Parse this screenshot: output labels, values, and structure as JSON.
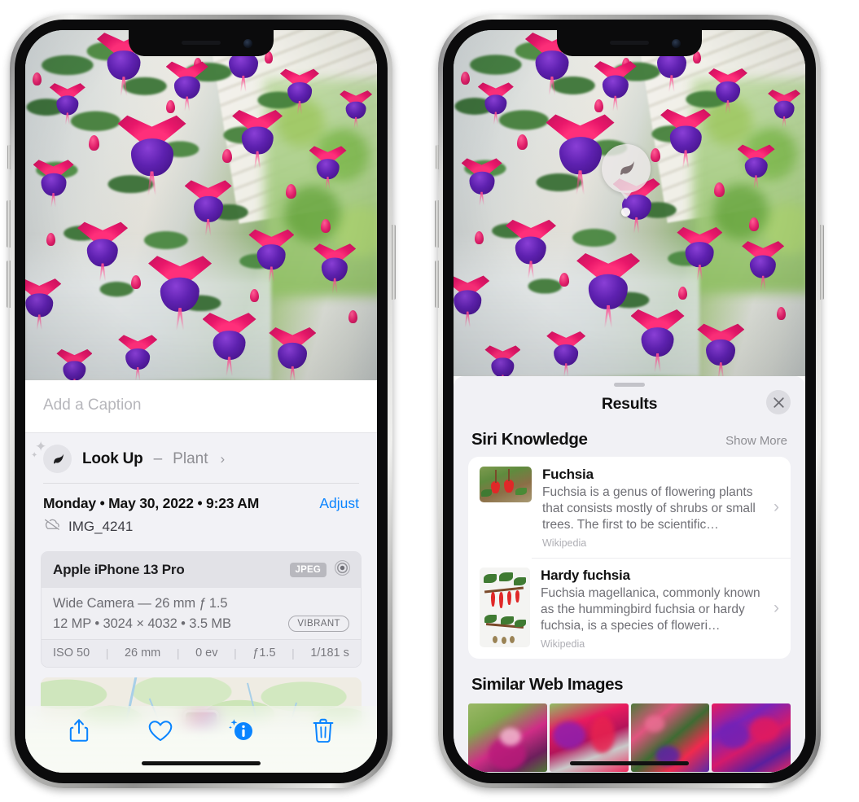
{
  "left_phone": {
    "caption_field": {
      "placeholder": "Add a Caption",
      "value": ""
    },
    "lookup": {
      "icon": "leaf-icon",
      "sparkle_icon": "sparkles-icon",
      "title": "Look Up",
      "dash": "–",
      "kind": "Plant",
      "chevron": "›"
    },
    "meta": {
      "date": "Monday • May 30, 2022 • 9:23 AM",
      "adjust_label": "Adjust",
      "cloud_icon": "cloud-slash-icon",
      "filename": "IMG_4241"
    },
    "camera_card": {
      "device": "Apple iPhone 13 Pro",
      "format_badge": "JPEG",
      "aperture_icon": "aperture-icon",
      "lens": "Wide Camera — 26 mm ƒ 1.5",
      "size_line": "12 MP • 3024 × 4032 • 3.5 MB",
      "style_badge": "VIBRANT",
      "exif": [
        "ISO 50",
        "26 mm",
        "0 ev",
        "ƒ1.5",
        "1/181 s"
      ],
      "exif_separator": "|"
    },
    "map_card": {
      "name": "photo-location-map",
      "pin": "photo-thumbnail-pin"
    },
    "toolbar": [
      {
        "name": "share-button",
        "icon": "share-icon"
      },
      {
        "name": "favorite-button",
        "icon": "heart-icon"
      },
      {
        "name": "info-button",
        "icon": "info-sparkles-icon",
        "active": true
      },
      {
        "name": "delete-button",
        "icon": "trash-icon"
      }
    ]
  },
  "right_phone": {
    "pin_badge": {
      "icon": "leaf-icon",
      "label": "visual-look-up-badge"
    },
    "sheet": {
      "grabber": "sheet-grabber",
      "title": "Results",
      "close_icon": "close-icon"
    },
    "siri_knowledge": {
      "heading": "Siri Knowledge",
      "show_more": "Show More",
      "items": [
        {
          "title": "Fuchsia",
          "description": "Fuchsia is a genus of flowering plants that consists mostly of shrubs or small trees. The first to be scientific…",
          "source": "Wikipedia",
          "chevron": "›"
        },
        {
          "title": "Hardy fuchsia",
          "description": "Fuchsia magellanica, commonly known as the hummingbird fuchsia or hardy fuchsia, is a species of floweri…",
          "source": "Wikipedia",
          "chevron": "›"
        }
      ]
    },
    "similar_web_images": {
      "heading": "Similar Web Images",
      "tiles": [
        "web-image-1",
        "web-image-2",
        "web-image-3",
        "web-image-4"
      ]
    }
  },
  "colors": {
    "accent_blue": "#0a84ff",
    "sheet_bg": "#f1f1f5",
    "card_bg": "#ffffff",
    "secondary_text": "#8e8e93",
    "badge_gray": "#b8b8be"
  }
}
